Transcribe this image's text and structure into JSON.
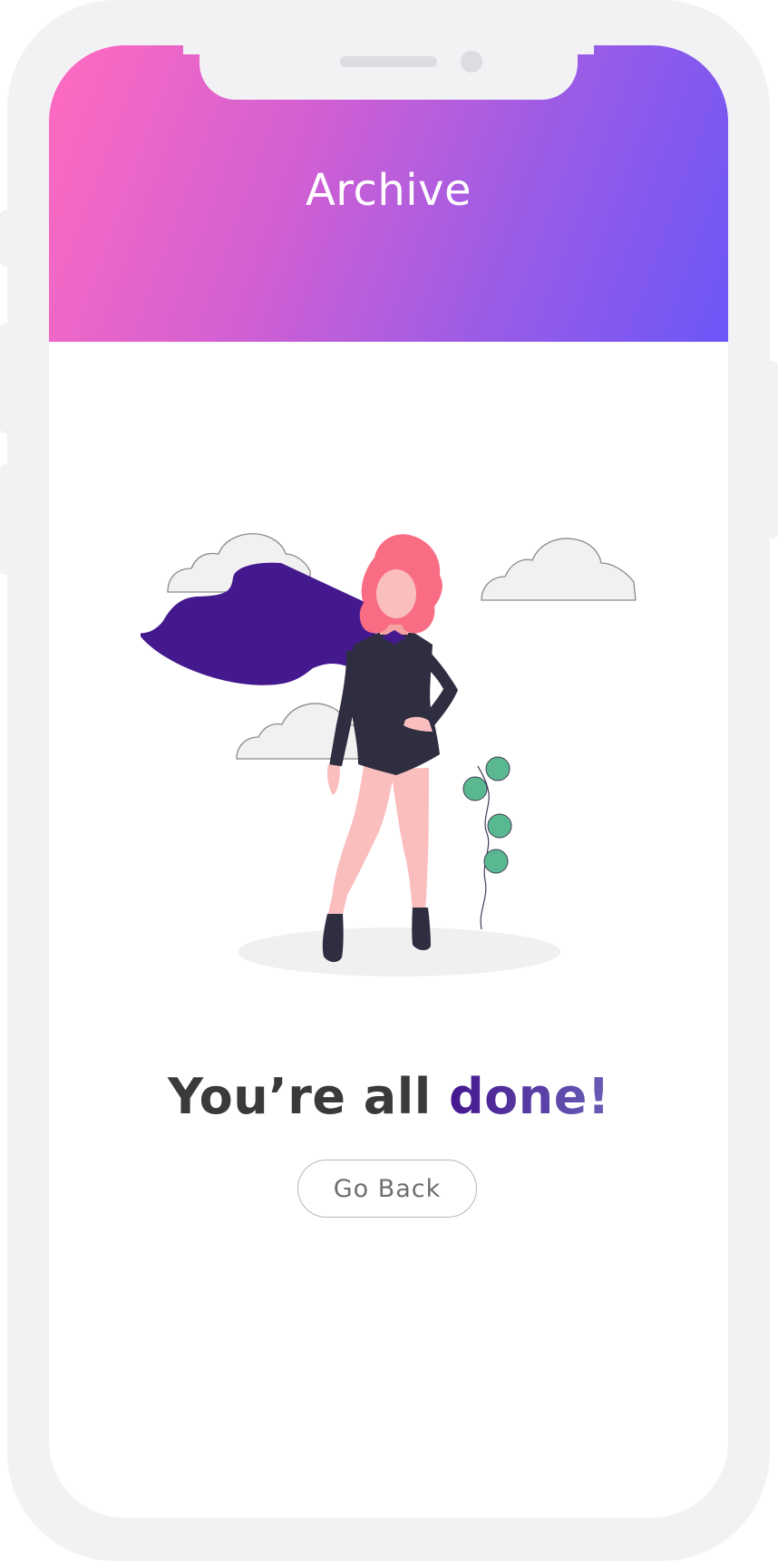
{
  "header": {
    "title": "Archive"
  },
  "main": {
    "heading_prefix": "You’re all ",
    "heading_accent": "done!",
    "go_back_label": "Go Back"
  },
  "illustration": {
    "icon": "superhero-woman-illustration",
    "cape_color": "#45198e",
    "hair_color": "#f86d84",
    "leaf_color": "#5ab891"
  },
  "colors": {
    "header_gradient_start": "#ff6bbf",
    "header_gradient_end": "#6c56f7",
    "heading_text": "#3a3a3c",
    "accent_start": "#45168f",
    "accent_end": "#6a5fb6"
  }
}
